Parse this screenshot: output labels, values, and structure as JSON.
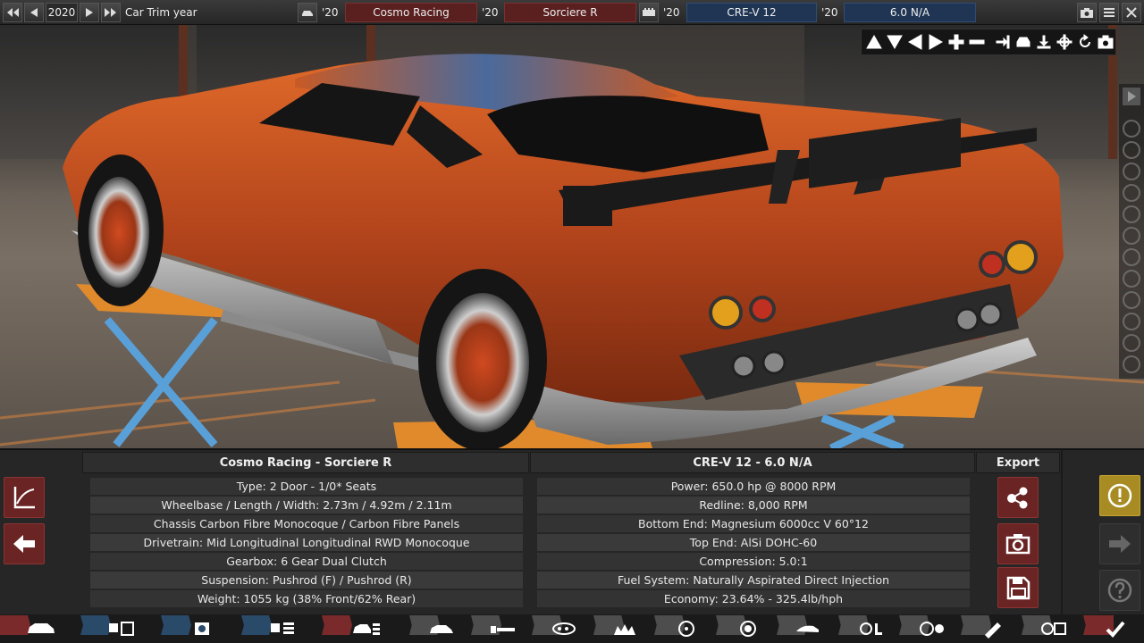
{
  "topbar": {
    "year": "2020",
    "trim_year_label": "Car Trim year",
    "model_year": "'20",
    "model_name": "Cosmo Racing",
    "trim_year": "'20",
    "trim_name": "Sorciere R",
    "engine_family_year": "'20",
    "engine_family_name": "CRE-V 12",
    "engine_variant_year": "'20",
    "engine_variant_name": "6.0 N/A"
  },
  "car_panel": {
    "header": "Cosmo Racing - Sorciere R",
    "rows": [
      "Type: 2 Door - 1/0* Seats",
      "Wheelbase / Length / Width: 2.73m / 4.92m / 2.11m",
      "Chassis Carbon Fibre Monocoque / Carbon Fibre Panels",
      "Drivetrain: Mid Longitudinal Longitudinal RWD Monocoque",
      "Gearbox: 6 Gear Dual Clutch",
      "Suspension: Pushrod (F) / Pushrod (R)",
      "Weight: 1055 kg (38% Front/62% Rear)"
    ]
  },
  "engine_panel": {
    "header": "CRE-V 12 - 6.0 N/A",
    "rows": [
      "Power: 650.0 hp @ 8000 RPM",
      "Redline:  8,000 RPM",
      "Bottom End: Magnesium 6000cc V 60°12",
      "Top End: AlSi DOHC-60",
      "Compression: 5.0:1",
      "Fuel System: Naturally Aspirated Direct Injection",
      "Economy: 23.64% - 325.4lb/hph"
    ]
  },
  "export_panel": {
    "header": "Export"
  },
  "colors": {
    "accent_red": "#6a2424",
    "accent_blue": "#1f3553",
    "warning_gold": "#a88b22"
  },
  "tabs": [
    "car-model-tab",
    "engine-family-tab",
    "engine-variant-tab",
    "engine-config-tab",
    "trim-tab",
    "body-tab",
    "chassis-tab",
    "fixtures-tab",
    "wheels-tab",
    "brakes-tab",
    "interior-tab",
    "aero-tab",
    "steering-tab",
    "drivetrain-tab",
    "paint-tab",
    "test-track-tab",
    "finish-tab"
  ]
}
